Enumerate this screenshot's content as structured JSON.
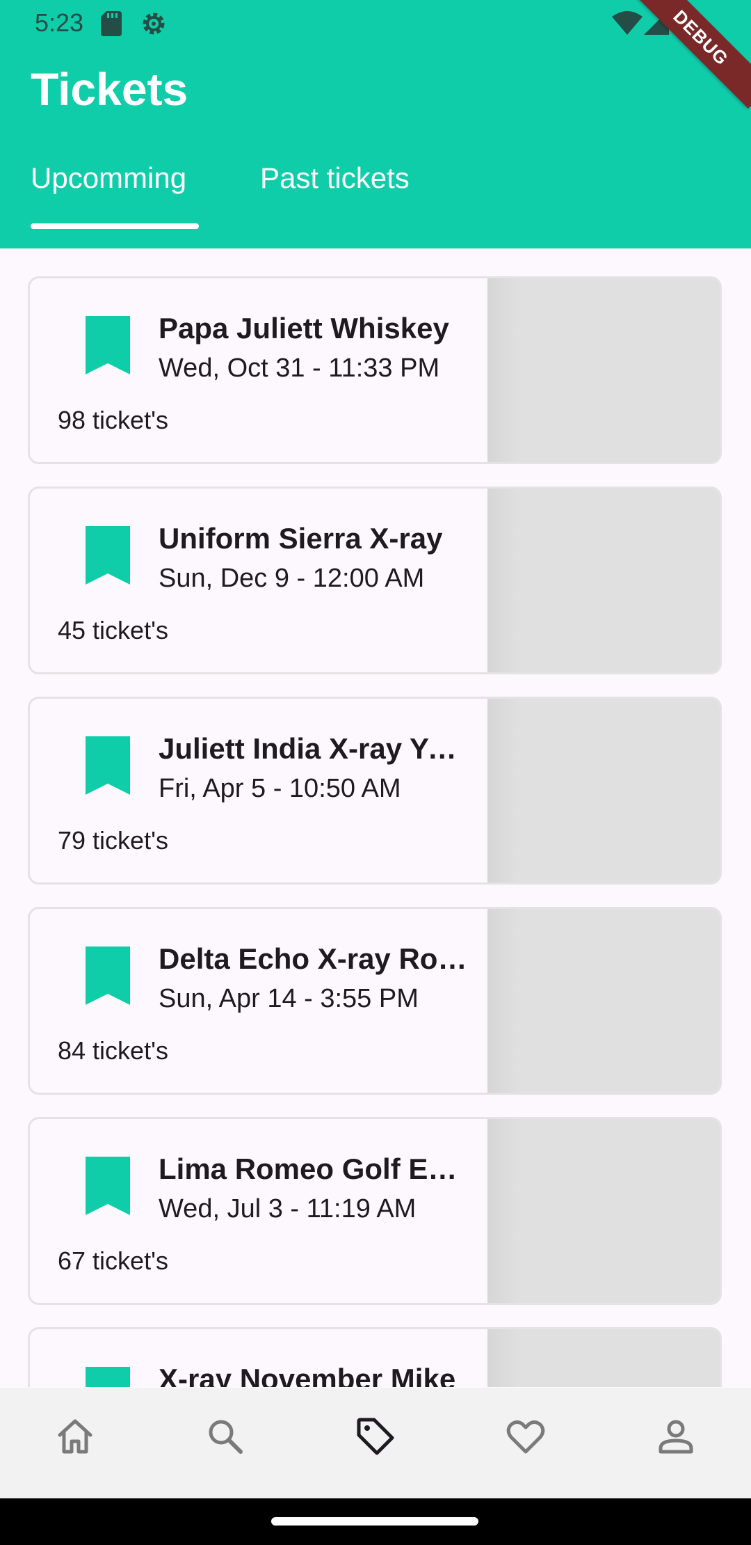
{
  "status_bar": {
    "time": "5:23",
    "debug_label": "DEBUG"
  },
  "header": {
    "title": "Tickets"
  },
  "tabs": [
    {
      "label": "Upcomming",
      "selected": true
    },
    {
      "label": "Past tickets",
      "selected": false
    }
  ],
  "colors": {
    "primary": "#10cdaa",
    "background": "#fdf8fd",
    "nav_background": "#f2f2f2",
    "placeholder": "#e0e0e0"
  },
  "tickets": [
    {
      "title": "Papa Juliett Whiskey",
      "date": "Wed, Oct 31 - 11:33 PM",
      "count": "98 ticket's"
    },
    {
      "title": "Uniform Sierra X-ray",
      "date": "Sun, Dec 9 - 12:00 AM",
      "count": "45 ticket's"
    },
    {
      "title": "Juliett India X-ray Yankee",
      "date": "Fri, Apr 5 - 10:50 AM",
      "count": "79 ticket's"
    },
    {
      "title": "Delta Echo X-ray Romeo",
      "date": "Sun, Apr 14 - 3:55 PM",
      "count": "84 ticket's"
    },
    {
      "title": "Lima Romeo Golf Echo",
      "date": "Wed, Jul 3 - 11:19 AM",
      "count": "67 ticket's"
    },
    {
      "title": "X-ray November Mike",
      "date": "",
      "count": ""
    }
  ],
  "bottom_nav": [
    {
      "icon": "home-icon",
      "selected": false
    },
    {
      "icon": "search-icon",
      "selected": false
    },
    {
      "icon": "tag-icon",
      "selected": true
    },
    {
      "icon": "heart-icon",
      "selected": false
    },
    {
      "icon": "person-icon",
      "selected": false
    }
  ]
}
